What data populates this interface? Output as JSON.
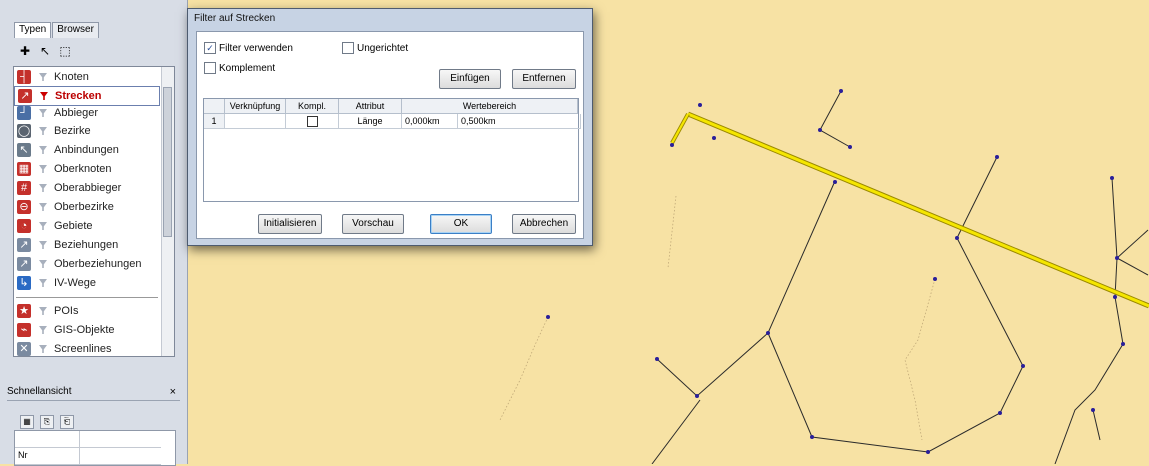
{
  "left_panel": {
    "tabs": [
      "Typen",
      "Browser"
    ],
    "list_items": [
      {
        "label": "Knoten",
        "icon": "node-icon",
        "filter_active": false,
        "selected": false
      },
      {
        "label": "Strecken",
        "icon": "link-icon",
        "filter_active": true,
        "selected": true
      },
      {
        "label": "Abbieger",
        "icon": "turn-icon",
        "filter_active": false,
        "selected": false
      },
      {
        "label": "Bezirke",
        "icon": "zone-icon",
        "filter_active": false,
        "selected": false
      },
      {
        "label": "Anbindungen",
        "icon": "connector-icon",
        "filter_active": false,
        "selected": false
      },
      {
        "label": "Oberknoten",
        "icon": "main-node-icon",
        "filter_active": false,
        "selected": false
      },
      {
        "label": "Oberabbieger",
        "icon": "main-turn-icon",
        "filter_active": false,
        "selected": false
      },
      {
        "label": "Oberbezirke",
        "icon": "main-zone-icon",
        "filter_active": false,
        "selected": false
      },
      {
        "label": "Gebiete",
        "icon": "territory-icon",
        "filter_active": false,
        "selected": false
      },
      {
        "label": "Beziehungen",
        "icon": "od-pair-icon",
        "filter_active": false,
        "selected": false
      },
      {
        "label": "Oberbeziehungen",
        "icon": "main-od-pair-icon",
        "filter_active": false,
        "selected": false
      },
      {
        "label": "IV-Wege",
        "icon": "prt-path-icon",
        "filter_active": false,
        "selected": false
      },
      {
        "label": "POIs",
        "icon": "poi-icon",
        "filter_active": false,
        "selected": false
      },
      {
        "label": "GIS-Objekte",
        "icon": "gis-object-icon",
        "filter_active": false,
        "selected": false
      },
      {
        "label": "Screenlines",
        "icon": "screenline-icon",
        "filter_active": false,
        "selected": false
      }
    ],
    "quick_view": {
      "title": "Schnellansicht",
      "close": "×",
      "row_label": "Nr"
    }
  },
  "dialog": {
    "title": "Filter auf Strecken",
    "use_filter_label": "Filter verwenden",
    "use_filter_checked": true,
    "complement_label": "Komplement",
    "complement_checked": false,
    "undirected_label": "Ungerichtet",
    "undirected_checked": false,
    "insert_button": "Einfügen",
    "remove_button": "Entfernen",
    "table": {
      "headers": [
        "Verknüpfung",
        "Kompl.",
        "Attribut",
        "Wertebereich"
      ],
      "rows": [
        {
          "nr": "1",
          "link": "",
          "compl_checked": false,
          "attribute": "Länge",
          "from": "0,000km",
          "to": "0,500km"
        }
      ]
    },
    "init_button": "Initialisieren",
    "preview_button": "Vorschau",
    "ok_button": "OK",
    "cancel_button": "Abbrechen"
  },
  "colors": {
    "map_background": "#f7e2a4",
    "selected_link": "#f2e400",
    "link": "#333333",
    "node": "#2a1f9a",
    "filter_active": "#cc0000"
  }
}
